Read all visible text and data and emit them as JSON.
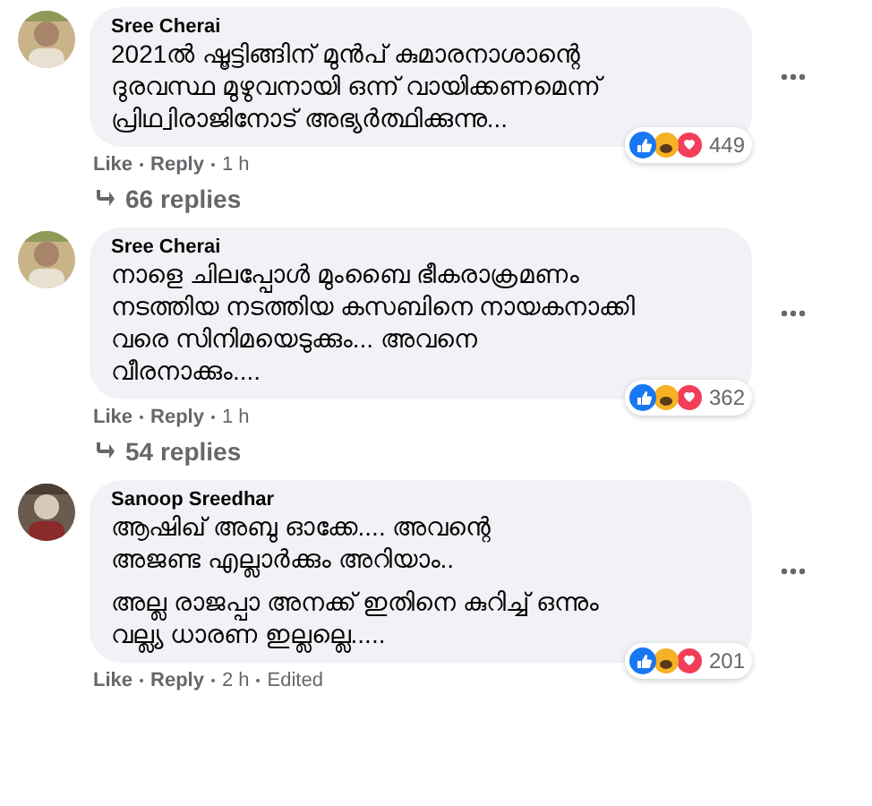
{
  "comments": [
    {
      "author": "Sree Cherai",
      "paragraphs": [
        [
          "2021ൽ ഷൂട്ടിങ്ങിന് മുൻപ് കുമാരനാശാന്റെ",
          "ദുരവസ്ഥ മുഴുവനായി ഒന്ന് വായിക്കണമെന്ന്",
          "പ്രിഥ്വിരാജിനോട് അഭ്യർത്ഥിക്കുന്നു..."
        ]
      ],
      "reaction_count": "449",
      "actions": [
        "Like",
        "Reply"
      ],
      "time": "1 h",
      "replies": "66 replies"
    },
    {
      "author": "Sree Cherai",
      "paragraphs": [
        [
          "നാളെ ചിലപ്പോൾ മുംബൈ ഭീകരാക്രമണം",
          "നടത്തിയ നടത്തിയ കസബിനെ നായകനാക്കി",
          "വരെ സിനിമയെടുക്കും... അവനെ",
          "വീരനാക്കും...."
        ]
      ],
      "reaction_count": "362",
      "actions": [
        "Like",
        "Reply"
      ],
      "time": "1 h",
      "replies": "54 replies"
    },
    {
      "author": "Sanoop Sreedhar",
      "paragraphs": [
        [
          "ആഷിഖ് അബു ഓക്കേ.... അവന്റെ",
          "അജണ്ട എല്ലാർക്കും അറിയാം.."
        ],
        [
          "അല്ല രാജപ്പാ അനക്ക് ഇതിനെ കുറിച്ച് ഒന്നും",
          "വല്ല്യ ധാരണ ഇല്ലല്ലെ....."
        ]
      ],
      "reaction_count": "201",
      "actions": [
        "Like",
        "Reply"
      ],
      "time": "2 h",
      "edited": "Edited"
    }
  ]
}
